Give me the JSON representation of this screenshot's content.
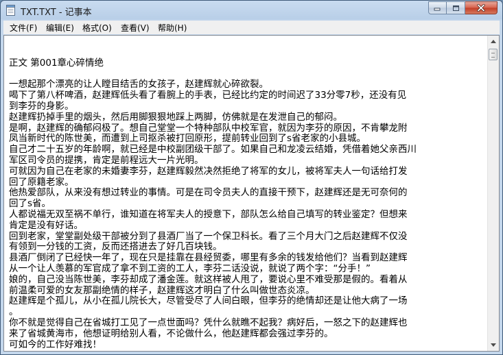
{
  "window": {
    "title": "TXT.TXT - 记事本"
  },
  "menu": [
    {
      "label": "文件(F)",
      "name": "menu-file"
    },
    {
      "label": "编辑(E)",
      "name": "menu-edit"
    },
    {
      "label": "格式(O)",
      "name": "menu-format"
    },
    {
      "label": "查看(V)",
      "name": "menu-view"
    },
    {
      "label": "帮助(H)",
      "name": "menu-help"
    }
  ],
  "editor": {
    "lines": [
      "",
      "正文 第001章心碎情绝",
      "",
      "一想起那个漂亮的让人瞠目结舌的女孩子，赵建辉就心碎欲裂。",
      "喝下了第八杯啤酒，赵建辉低头看了看腕上的手表，已经比约定的时间迟了33分零7秒，还没有见",
      "到李芬的身影。",
      "赵建辉扔掉手里的烟头，然后用脚狠狠地踩上两脚，仿佛就是在发泄自己的郁闷。",
      "是啊，赵建辉的确郁闷极了。想自己堂堂一个特种部队中校军官，就因为李芬的原因，不肯攀龙附",
      "凤当新时代的陈世美，而遭到上司抠杀被打回原形，提前转业回到了s省老家的小县城。",
      "自己才二十五岁的年龄啊，就已经是中校副团级干部了。如果自己和龙凌云结婚，凭借着她父亲西川",
      "军区司令员的提携，肯定是前程远大一片光明。",
      "可就因为自己在老家的未婚妻李芬，赵建辉毅然决然拒绝了将军的女儿，被将军夫人一句话给打发",
      "回了原籍老家。",
      "他热爱部队，从来没有想过转业的事情。可是在司令员夫人的直接干预下，赵建辉还是无可奈何的",
      "回了s省。",
      "人都说福无双至祸不单行，谁知道在将军夫人的授意下，部队怎么给自己填写的转业鉴定？但想来",
      "肯定是没有好话。",
      "回到老家，堂堂副处级干部被分到了县酒厂当了一个保卫科长。看了三个月大门之后赵建辉不仅没",
      "有领到一分钱的工资，反而还搭进去了好几百块钱。",
      "县酒厂倒闭了已经快一年了，现在只是挂靠在县经贸委，哪里有多余的钱发给他们？当看到赵建辉",
      "从一个让人羡慕的军官成了拿不到工资的工人，李芬二话没说，就说了两个字：“分手！”",
      "娘的，自己没当陈世美，李芬却成了潘金莲。就这样被人甩了，要说心里不难受那是假的。看着从",
      "前温柔可爱的女友那副绝情的样子，赵建辉这才明白了什么叫做世态炎凉。",
      "赵建辉是个孤儿，从小在孤儿院长大，尽管受尽了人间白眼，但李芬的绝情却还是让他大病了一场",
      "。",
      "你不就是觉得自己在省城打工见了一点世面吗？凭什么就瞧不起我？病好后，一怒之下的赵建辉也",
      "来了省城黄海市，他想证明给别人看，不论做什么，他赵建辉都会强过李芬的。",
      "可如今的工作好难找！"
    ]
  }
}
